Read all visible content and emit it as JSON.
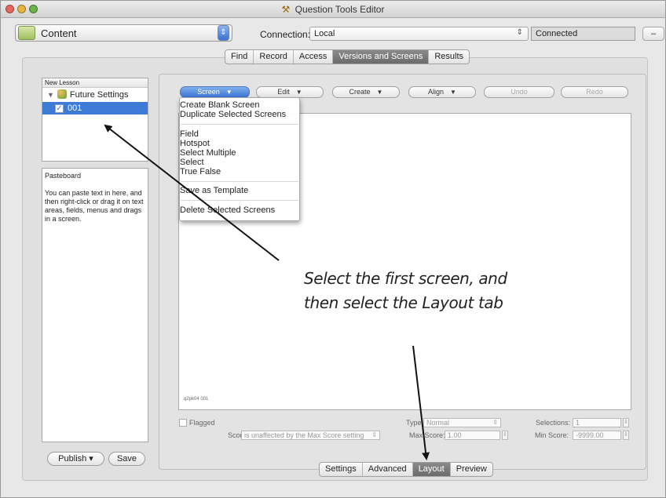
{
  "window": {
    "title": "Question Tools Editor",
    "app_icon": "tools-icon"
  },
  "toolbar": {
    "content_label": "Content",
    "connection_label": "Connection:",
    "connection_value": "Local",
    "status": "Connected",
    "minus_label": "–"
  },
  "top_tabs": [
    {
      "label": "Find",
      "active": false
    },
    {
      "label": "Record",
      "active": false
    },
    {
      "label": "Access",
      "active": false
    },
    {
      "label": "Versions and Screens",
      "active": true
    },
    {
      "label": "Results",
      "active": false
    }
  ],
  "bottom_tabs": [
    {
      "label": "Settings",
      "active": false
    },
    {
      "label": "Advanced",
      "active": false
    },
    {
      "label": "Layout",
      "active": true
    },
    {
      "label": "Preview",
      "active": false
    }
  ],
  "lesson_tree": {
    "header": "New Lesson",
    "folder_label": "Future Settings",
    "selected_item": "001"
  },
  "pasteboard": {
    "title": "Pasteboard",
    "body": "You can paste text in here, and then right-click or drag it on text areas, fields, menus and drags in a screen."
  },
  "left_buttons": {
    "publish": "Publish ▾",
    "save": "Save"
  },
  "screen_toolbar": {
    "screen": "Screen",
    "edit": "Edit",
    "create": "Create",
    "align": "Align",
    "undo": "Undo",
    "redo": "Redo"
  },
  "screen_menu": {
    "items": [
      "Create Blank Screen",
      "Duplicate Selected Screens",
      "Field",
      "Hotspot",
      "Select Multiple",
      "Select",
      "True False",
      "Save as Template",
      "Delete Selected Screens"
    ]
  },
  "canvas": {
    "screen_id": "q2pk04 001"
  },
  "properties": {
    "flagged_label": "Flagged",
    "score_label": "Score:",
    "score_value": "is unaffected by the Max Score setting",
    "type_label": "Type:",
    "type_value": "Normal",
    "max_score_label": "Max Score:",
    "max_score_value": "1.00",
    "selections_label": "Selections:",
    "selections_value": "1",
    "min_score_label": "Min Score:",
    "min_score_value": "-9999.00"
  },
  "annotation": {
    "line1": "Select the first screen, and",
    "line2": "then select the Layout tab"
  },
  "colors": {
    "selection_blue": "#3e7bd6",
    "active_tab_gray": "#6b6b6b"
  }
}
